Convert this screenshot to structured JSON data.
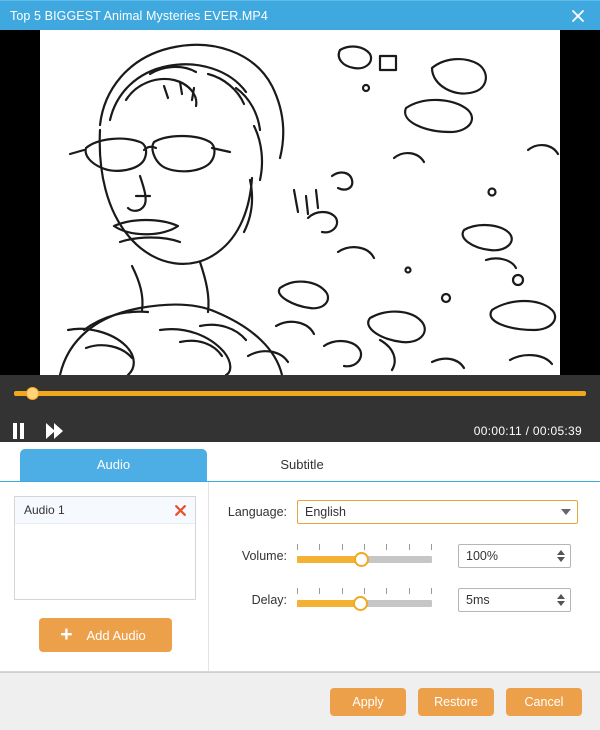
{
  "titlebar": {
    "title": "Top 5 BIGGEST Animal Mysteries EVER.MP4",
    "close_icon": "close-icon",
    "background": "#3FA9DF"
  },
  "player": {
    "seek_percent": 3.2,
    "pause_icon": "pause-icon",
    "forward_icon": "fast-forward-icon",
    "current_time": "00:00:11",
    "separator": "/",
    "total_time": "00:05:39",
    "time_display": "00:00:11 / 00:05:39",
    "track_color": "#F0A91E"
  },
  "tabs": [
    {
      "label": "Audio",
      "active": true
    },
    {
      "label": "Subtitle",
      "active": false
    }
  ],
  "audio_panel": {
    "tracks": [
      {
        "name": "Audio 1",
        "delete_icon": "delete-icon"
      }
    ],
    "add_button": {
      "label": "Add Audio",
      "icon": "plus-icon",
      "color": "#EDA04A"
    },
    "fields": {
      "language": {
        "label": "Language:",
        "value": "English",
        "options": [
          "English"
        ],
        "caret_icon": "chevron-down-icon",
        "border_color": "#E8A33D"
      },
      "volume": {
        "label": "Volume:",
        "value": "100%",
        "slider_percent": 48,
        "tick_count": 7
      },
      "delay": {
        "label": "Delay:",
        "value": "5ms",
        "slider_percent": 47,
        "tick_count": 7
      }
    }
  },
  "footer": {
    "buttons": [
      {
        "label": "Apply"
      },
      {
        "label": "Restore"
      },
      {
        "label": "Cancel"
      }
    ]
  }
}
